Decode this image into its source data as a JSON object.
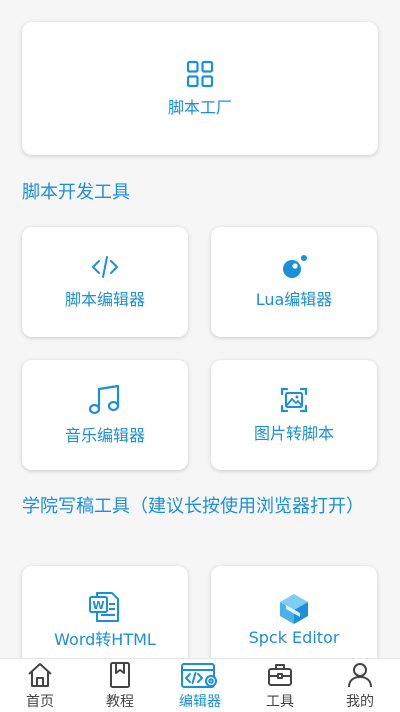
{
  "top_card": {
    "label": "脚本工厂",
    "icon": "grid-icon"
  },
  "section_dev": {
    "title": "脚本开发工具"
  },
  "dev_tools": [
    {
      "label": "脚本编辑器",
      "icon": "code-icon"
    },
    {
      "label": "Lua编辑器",
      "icon": "lua-icon"
    },
    {
      "label": "音乐编辑器",
      "icon": "music-icon"
    },
    {
      "label": "图片转脚本",
      "icon": "image-scan-icon"
    }
  ],
  "section_college": {
    "title": "学院写稿工具（建议长按使用浏览器打开）"
  },
  "college_tools": [
    {
      "label": "Word转HTML",
      "icon": "word-icon"
    },
    {
      "label": "Spck Editor",
      "icon": "spck-icon"
    }
  ],
  "bottom_nav": {
    "items": [
      {
        "label": "首页",
        "icon": "home-icon"
      },
      {
        "label": "教程",
        "icon": "bookmark-icon"
      },
      {
        "label": "编辑器",
        "icon": "editor-icon",
        "active": true
      },
      {
        "label": "工具",
        "icon": "toolbox-icon"
      },
      {
        "label": "我的",
        "icon": "user-icon"
      }
    ]
  },
  "colors": {
    "accent": "#1a8fdc",
    "background": "#f6f6f6",
    "card": "#ffffff"
  }
}
